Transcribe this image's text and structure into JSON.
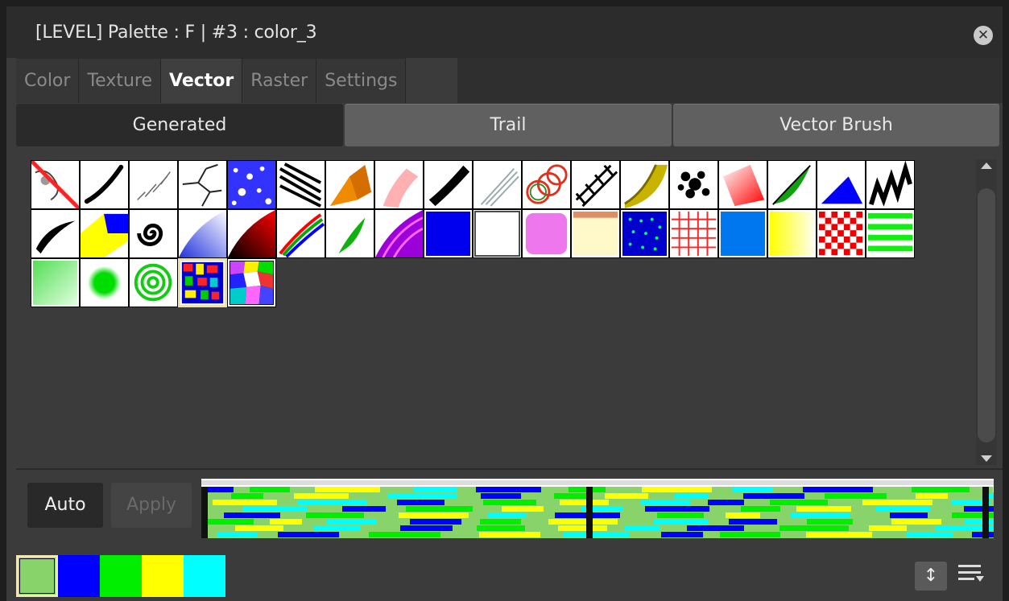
{
  "window": {
    "title": "[LEVEL]  Palette : F | #3 : color_3",
    "close_icon": "close-icon"
  },
  "tabs": [
    {
      "label": "Color",
      "active": false
    },
    {
      "label": "Texture",
      "active": false
    },
    {
      "label": "Vector",
      "active": true
    },
    {
      "label": "Raster",
      "active": false
    },
    {
      "label": "Settings",
      "active": false
    }
  ],
  "subtabs": [
    {
      "label": "Generated",
      "active": true
    },
    {
      "label": "Trail",
      "active": false
    },
    {
      "label": "Vector Brush",
      "active": false
    }
  ],
  "chips": [
    {
      "name": "chip-none"
    },
    {
      "name": "chip-brush-stroke"
    },
    {
      "name": "chip-spray-lines"
    },
    {
      "name": "chip-crack"
    },
    {
      "name": "chip-blue-dots"
    },
    {
      "name": "chip-hatch-lines"
    },
    {
      "name": "chip-orange-fold"
    },
    {
      "name": "chip-pink-ribbon"
    },
    {
      "name": "chip-black-brush"
    },
    {
      "name": "chip-gray-strokes"
    },
    {
      "name": "chip-red-rings"
    },
    {
      "name": "chip-track"
    },
    {
      "name": "chip-gold-wave"
    },
    {
      "name": "chip-noise"
    },
    {
      "name": "chip-red-gradient"
    },
    {
      "name": "chip-green-leaf"
    },
    {
      "name": "chip-blue-triangle"
    },
    {
      "name": "chip-black-zigzag"
    },
    {
      "name": "chip-black-curve"
    },
    {
      "name": "chip-yellow-blue"
    },
    {
      "name": "chip-spiral"
    },
    {
      "name": "chip-blue-fade"
    },
    {
      "name": "chip-red-black-fade"
    },
    {
      "name": "chip-rgb-stripes"
    },
    {
      "name": "chip-green-feather"
    },
    {
      "name": "chip-purple-waves"
    },
    {
      "name": "chip-blue-square"
    },
    {
      "name": "chip-white-square"
    },
    {
      "name": "chip-pink-square"
    },
    {
      "name": "chip-cream-square"
    },
    {
      "name": "chip-dotted-square"
    },
    {
      "name": "chip-grid-square"
    },
    {
      "name": "chip-sky-square"
    },
    {
      "name": "chip-yellow-gradient"
    },
    {
      "name": "chip-checker"
    },
    {
      "name": "chip-green-stripes"
    },
    {
      "name": "chip-green-gradient"
    },
    {
      "name": "chip-green-radial"
    },
    {
      "name": "chip-green-rings"
    },
    {
      "name": "chip-mosaic"
    },
    {
      "name": "chip-voronoi"
    }
  ],
  "selected_chip_index": 39,
  "controls": {
    "auto_label": "Auto",
    "apply_label": "Apply",
    "apply_enabled": false
  },
  "swatches": [
    {
      "color": "#88d46a",
      "selected": true
    },
    {
      "color": "#0000ff",
      "selected": false
    },
    {
      "color": "#00ee00",
      "selected": false
    },
    {
      "color": "#ffff00",
      "selected": false
    },
    {
      "color": "#00ffff",
      "selected": false
    }
  ],
  "bottom_icons": [
    "updown-arrow-icon",
    "menu-icon"
  ]
}
